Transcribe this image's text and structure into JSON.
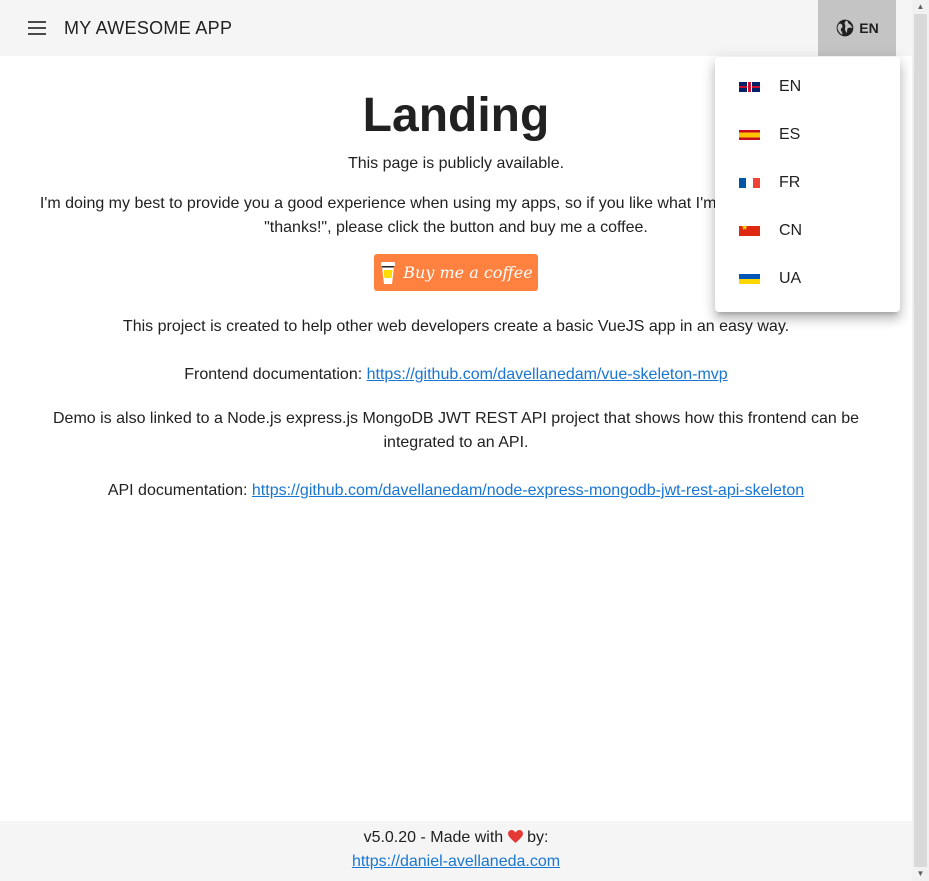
{
  "header": {
    "title": "MY AWESOME APP",
    "language_button": "EN"
  },
  "main": {
    "title": "Landing",
    "subtitle": "This page is publicly available.",
    "intro": "I'm doing my best to provide you a good experience when using my apps, so if you like what I'm doing and wanna say \"thanks!\", please click the button and buy me a coffee.",
    "coffee_button": "Buy me a coffee",
    "project_desc": "This project is created to help other web developers create a basic VueJS app in an easy way.",
    "frontend_doc_label": "Frontend documentation:",
    "frontend_doc_url": "https://github.com/davellanedam/vue-skeleton-mvp",
    "demo_desc": "Demo is also linked to a Node.js express.js MongoDB JWT REST API project that shows how this frontend can be integrated to an API.",
    "api_doc_label": "API documentation:",
    "api_doc_url": "https://github.com/davellanedam/node-express-mongodb-jwt-rest-api-skeleton"
  },
  "footer": {
    "version_text": "v5.0.20 - Made with",
    "by_text": "by:",
    "author_url": "https://daniel-avellaneda.com"
  },
  "language_menu": {
    "items": [
      {
        "code": "EN",
        "flag": "gb-flag"
      },
      {
        "code": "ES",
        "flag": "es-flag"
      },
      {
        "code": "FR",
        "flag": "fr-flag"
      },
      {
        "code": "CN",
        "flag": "cn-flag"
      },
      {
        "code": "UA",
        "flag": "ua-flag"
      }
    ]
  },
  "colors": {
    "topbar_bg": "#f5f5f5",
    "language_button_bg": "#c4c4c4",
    "coffee_button_bg": "#ff813f",
    "link": "#1976d2",
    "heart": "#e53935"
  }
}
